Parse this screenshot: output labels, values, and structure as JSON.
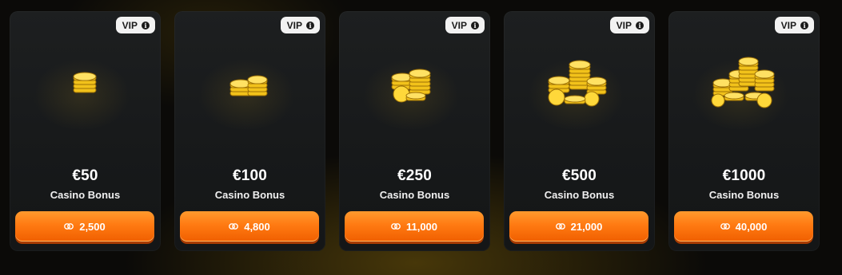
{
  "cards": [
    {
      "badge": "VIP",
      "amount": "€50",
      "subtitle": "Casino Bonus",
      "price": "2,500"
    },
    {
      "badge": "VIP",
      "amount": "€100",
      "subtitle": "Casino Bonus",
      "price": "4,800"
    },
    {
      "badge": "VIP",
      "amount": "€250",
      "subtitle": "Casino Bonus",
      "price": "11,000"
    },
    {
      "badge": "VIP",
      "amount": "€500",
      "subtitle": "Casino Bonus",
      "price": "21,000"
    },
    {
      "badge": "VIP",
      "amount": "€1000",
      "subtitle": "Casino Bonus",
      "price": "40,000"
    }
  ],
  "colors": {
    "button": "#ff7a12",
    "card": "#1b1d1e",
    "gold": "#f2c21a"
  },
  "icons": {
    "badge": "info-icon",
    "price": "coins-icon",
    "art": "gold-coin-stack-icon"
  }
}
